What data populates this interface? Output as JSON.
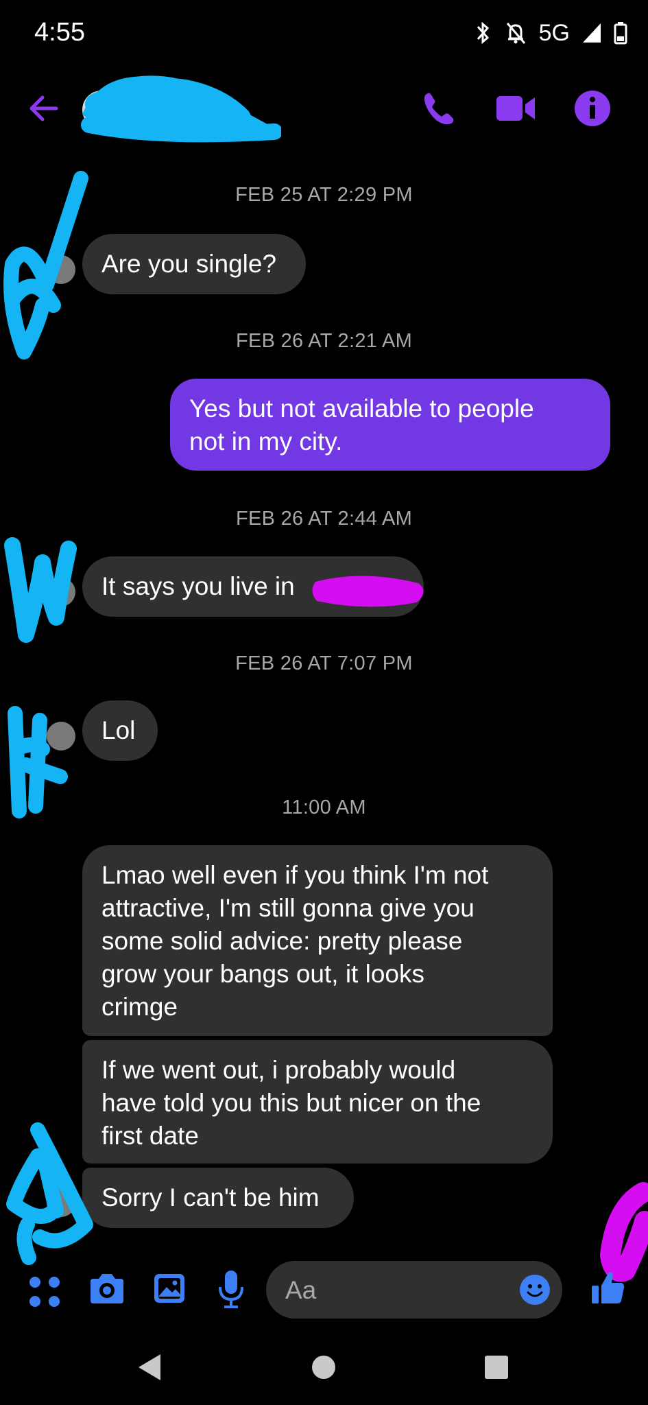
{
  "status_bar": {
    "time": "4:55",
    "network": "5G"
  },
  "header": {
    "contact_name": ""
  },
  "messages": [
    {
      "type": "timestamp",
      "text": "FEB 25 AT 2:29 PM"
    },
    {
      "type": "incoming",
      "lines": [
        "Are you single?"
      ]
    },
    {
      "type": "timestamp",
      "text": "FEB 26 AT 2:21 AM"
    },
    {
      "type": "outgoing",
      "lines": [
        "Yes but not available to people",
        "not in my city."
      ]
    },
    {
      "type": "timestamp",
      "text": "FEB 26 AT 2:44 AM"
    },
    {
      "type": "incoming",
      "lines": [
        "It says you live in"
      ]
    },
    {
      "type": "timestamp",
      "text": "FEB 26 AT 7:07 PM"
    },
    {
      "type": "incoming",
      "lines": [
        "Lol"
      ]
    },
    {
      "type": "timestamp",
      "text": "11:00 AM"
    },
    {
      "type": "incoming",
      "lines": [
        "Lmao well even if you think I'm not",
        "attractive,  I'm still gonna give you",
        "some solid advice: pretty please",
        "grow your bangs out, it looks",
        "crimge"
      ]
    },
    {
      "type": "incoming",
      "lines": [
        "If we went out, i probably would",
        "have told you this but nicer on the",
        "first date"
      ]
    },
    {
      "type": "incoming",
      "lines": [
        "Sorry I can't be him"
      ]
    }
  ],
  "composer": {
    "placeholder": "Aa"
  },
  "colors": {
    "accent": "#7238e3",
    "icon_purple": "#8b3bef",
    "icon_blue": "#3d7ff5",
    "incoming_bubble": "#303030",
    "scribble_blue": "#14b4f5",
    "scribble_magenta": "#d40ef0"
  },
  "icons": {
    "header": [
      "back-arrow-icon",
      "phone-icon",
      "video-camera-icon",
      "info-icon"
    ],
    "composer": [
      "menu-dots-icon",
      "camera-icon",
      "gallery-icon",
      "microphone-icon",
      "emoji-icon",
      "thumbs-up-icon"
    ],
    "navbar": [
      "back-triangle-icon",
      "home-circle-icon",
      "recents-square-icon"
    ]
  }
}
